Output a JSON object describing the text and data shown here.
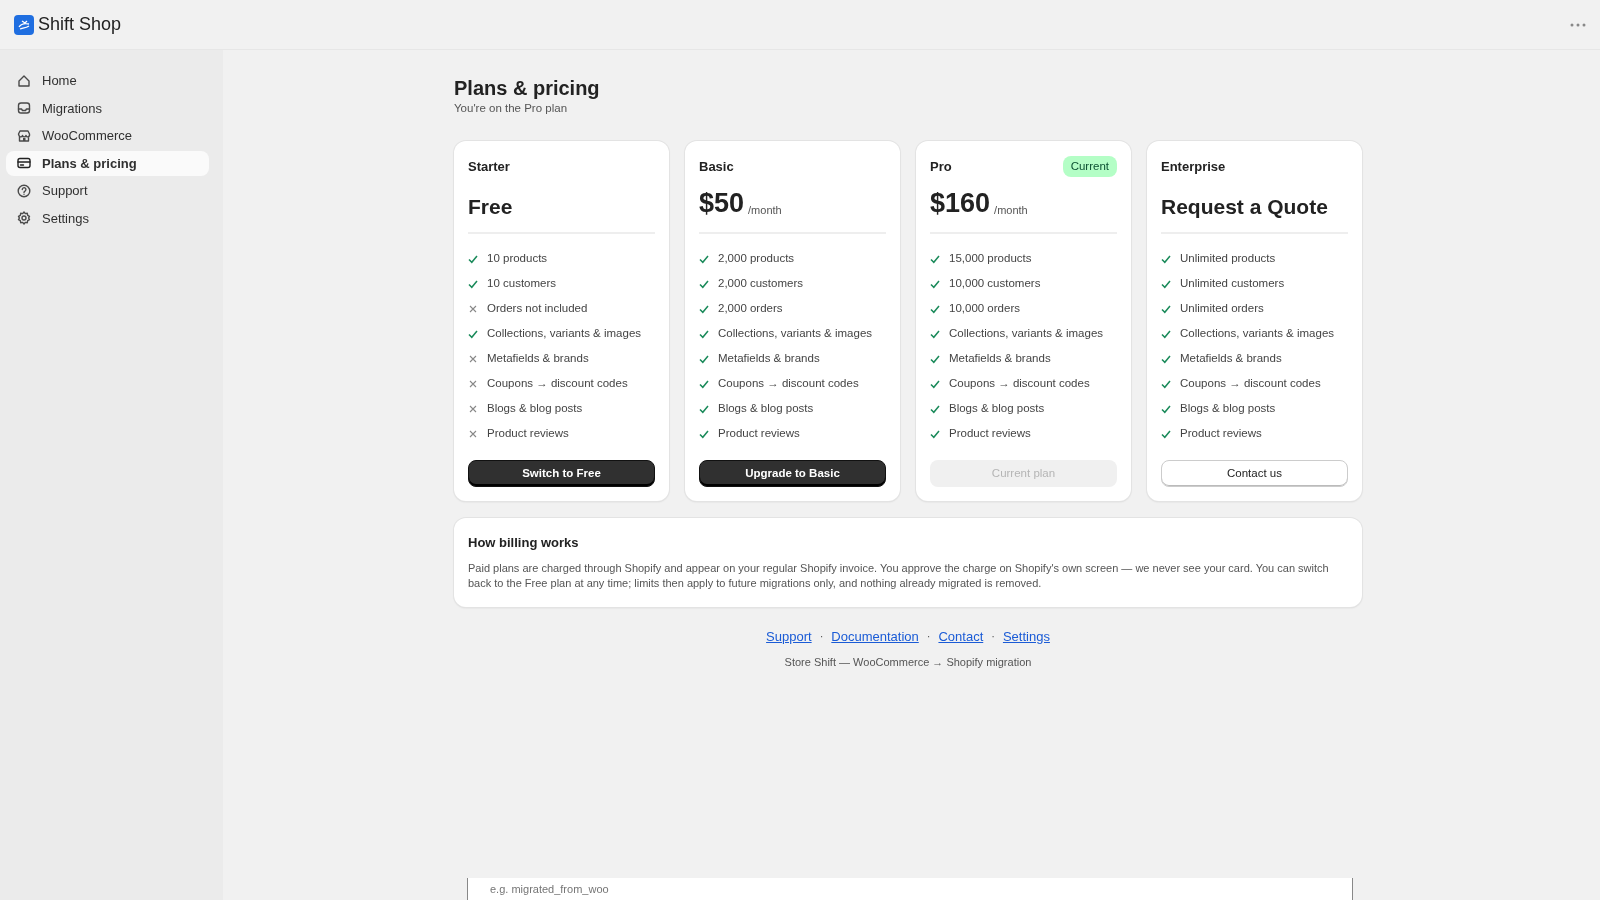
{
  "app": {
    "title": "Shift Shop"
  },
  "sidebar": {
    "items": [
      {
        "label": "Home",
        "selected": false
      },
      {
        "label": "Migrations",
        "selected": false
      },
      {
        "label": "WooCommerce",
        "selected": false
      },
      {
        "label": "Plans & pricing",
        "selected": true
      },
      {
        "label": "Support",
        "selected": false
      },
      {
        "label": "Settings",
        "selected": false
      }
    ]
  },
  "page": {
    "title": "Plans & pricing",
    "subtitle": "You're on the Pro plan"
  },
  "plans": [
    {
      "name": "Starter",
      "price": "Free",
      "features": [
        {
          "text": "10 products",
          "included": true
        },
        {
          "text": "10 customers",
          "included": true
        },
        {
          "text": "Orders not included",
          "included": false
        },
        {
          "text": "Collections, variants & images",
          "included": true
        },
        {
          "text": "Metafields & brands",
          "included": false
        },
        {
          "text": "Coupons → discount codes",
          "included": false
        },
        {
          "text": "Blogs & blog posts",
          "included": false
        },
        {
          "text": "Product reviews",
          "included": false
        }
      ],
      "button": {
        "label": "Switch to Free",
        "kind": "primary",
        "disabled": false
      }
    },
    {
      "name": "Basic",
      "price": "$50",
      "period": "/month",
      "features": [
        {
          "text": "2,000 products",
          "included": true
        },
        {
          "text": "2,000 customers",
          "included": true
        },
        {
          "text": "2,000 orders",
          "included": true
        },
        {
          "text": "Collections, variants & images",
          "included": true
        },
        {
          "text": "Metafields & brands",
          "included": true
        },
        {
          "text": "Coupons → discount codes",
          "included": true
        },
        {
          "text": "Blogs & blog posts",
          "included": true
        },
        {
          "text": "Product reviews",
          "included": true
        }
      ],
      "button": {
        "label": "Upgrade to Basic",
        "kind": "primary",
        "disabled": false
      }
    },
    {
      "name": "Pro",
      "price": "$160",
      "period": "/month",
      "badge": "Current",
      "features": [
        {
          "text": "15,000 products",
          "included": true
        },
        {
          "text": "10,000 customers",
          "included": true
        },
        {
          "text": "10,000 orders",
          "included": true
        },
        {
          "text": "Collections, variants & images",
          "included": true
        },
        {
          "text": "Metafields & brands",
          "included": true
        },
        {
          "text": "Coupons → discount codes",
          "included": true
        },
        {
          "text": "Blogs & blog posts",
          "included": true
        },
        {
          "text": "Product reviews",
          "included": true
        }
      ],
      "button": {
        "label": "Current plan",
        "kind": "primary",
        "disabled": true
      }
    },
    {
      "name": "Enterprise",
      "price": "Request a Quote",
      "features": [
        {
          "text": "Unlimited products",
          "included": true
        },
        {
          "text": "Unlimited customers",
          "included": true
        },
        {
          "text": "Unlimited orders",
          "included": true
        },
        {
          "text": "Collections, variants & images",
          "included": true
        },
        {
          "text": "Metafields & brands",
          "included": true
        },
        {
          "text": "Coupons → discount codes",
          "included": true
        },
        {
          "text": "Blogs & blog posts",
          "included": true
        },
        {
          "text": "Product reviews",
          "included": true
        }
      ],
      "button": {
        "label": "Contact us",
        "kind": "outline",
        "disabled": false
      }
    }
  ],
  "billing": {
    "title": "How billing works",
    "text": "Paid plans are charged through Shopify and appear on your regular Shopify invoice. You approve the charge on Shopify's own screen — we never see your card. You can switch back to the Free plan at any time; limits then apply to future migrations only, and nothing already migrated is removed."
  },
  "footer": {
    "links": [
      "Support",
      "Documentation",
      "Contact",
      "Settings"
    ],
    "separator": "·",
    "tagline": "Store Shift — WooCommerce → Shopify migration"
  },
  "partial_field": {
    "placeholder": "e.g. migrated_from_woo"
  }
}
